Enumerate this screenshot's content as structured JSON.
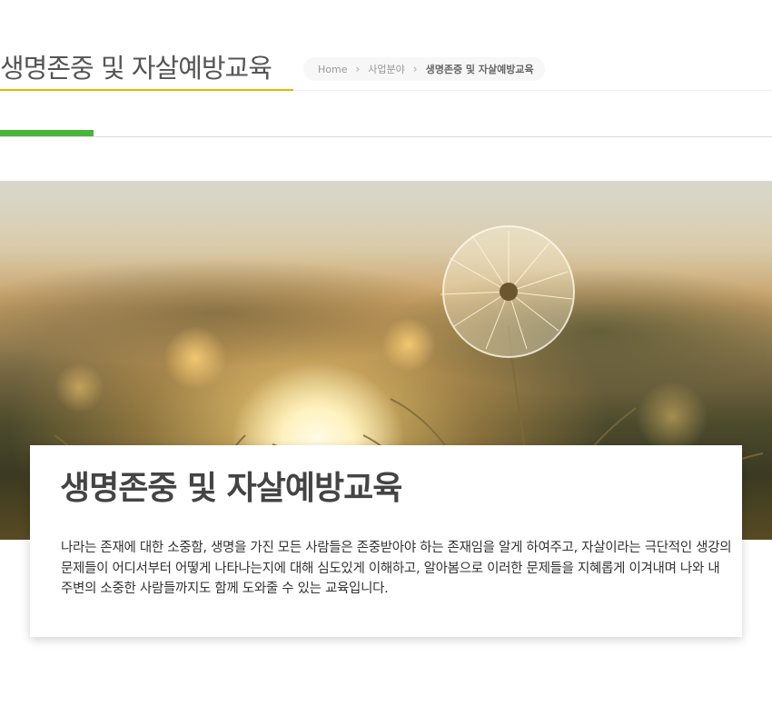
{
  "header": {
    "title": "생명존중 및 자살예방교육"
  },
  "breadcrumb": {
    "home": "Home",
    "section": "사업분야",
    "current": "생명존중 및 자살예방교육",
    "separator": "›"
  },
  "hero": {
    "image": "sunset-dandelion-field"
  },
  "card": {
    "title": "생명존중 및 자살예방교육",
    "description": "나라는 존재에 대한 소중함, 생명을 가진 모든 사람들은 존중받아야 하는 존재임을 알게 하여주고, 자살이라는 극단적인 생강의 문제들이 어디서부터 어떻게 나타나는지에 대해  심도있게 이해하고, 알아봄으로 이러한 문제들을 지혜롭게 이겨내며 나와 내 주변의 소중한 사람들까지도 함께 도와줄 수 있는 교육입니다."
  },
  "colors": {
    "title_underline": "#e8b400",
    "accent_bar": "#4bb43a"
  }
}
